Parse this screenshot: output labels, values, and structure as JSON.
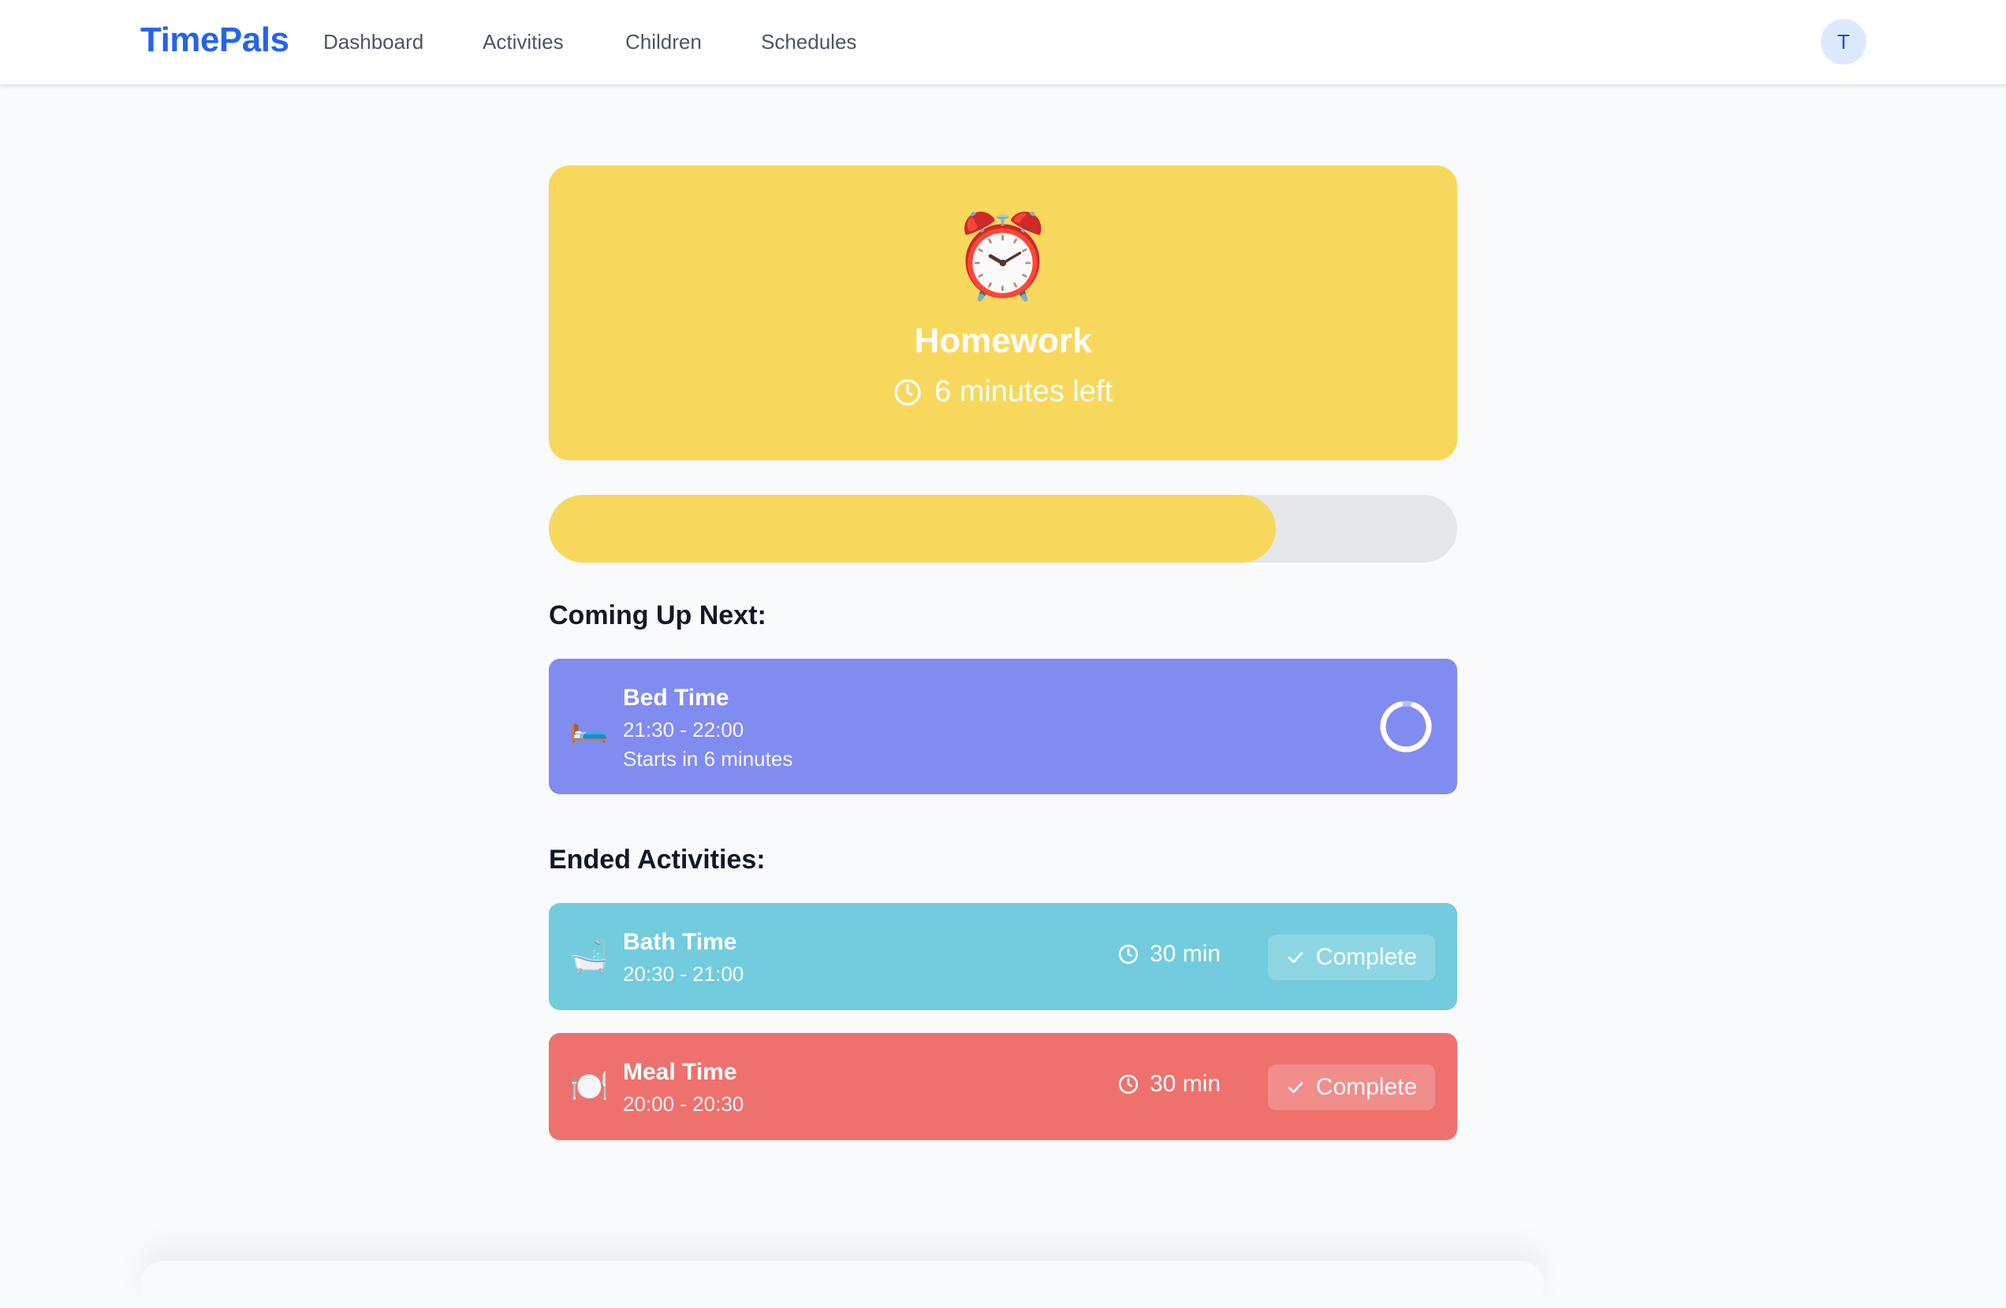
{
  "nav": {
    "brand": "TimePals",
    "links": [
      "Dashboard",
      "Activities",
      "Children",
      "Schedules"
    ],
    "avatar_initial": "T"
  },
  "current": {
    "emoji": "⏰",
    "title": "Homework",
    "time_left": "6 minutes left",
    "progress_fraction": 0.8,
    "color": "#f8d85c"
  },
  "upcoming": {
    "heading": "Coming Up Next:",
    "items": [
      {
        "emoji": "🛏️",
        "name": "Bed Time",
        "time_range": "21:30 - 22:00",
        "starts_in": "Starts in 6 minutes",
        "color": "#818cf0"
      }
    ]
  },
  "ended": {
    "heading": "Ended Activities:",
    "items": [
      {
        "emoji": "🛁",
        "name": "Bath Time",
        "time_range": "20:30 - 21:00",
        "duration": "30 min",
        "status_label": "Complete",
        "color": "#72ccdd"
      },
      {
        "emoji": "🍽️",
        "name": "Meal Time",
        "time_range": "20:00 - 20:30",
        "duration": "30 min",
        "status_label": "Complete",
        "color": "#ee716e"
      }
    ]
  },
  "icons": {
    "clock": "clock-icon",
    "check": "check-icon",
    "spinner": "loading-spinner-icon"
  }
}
